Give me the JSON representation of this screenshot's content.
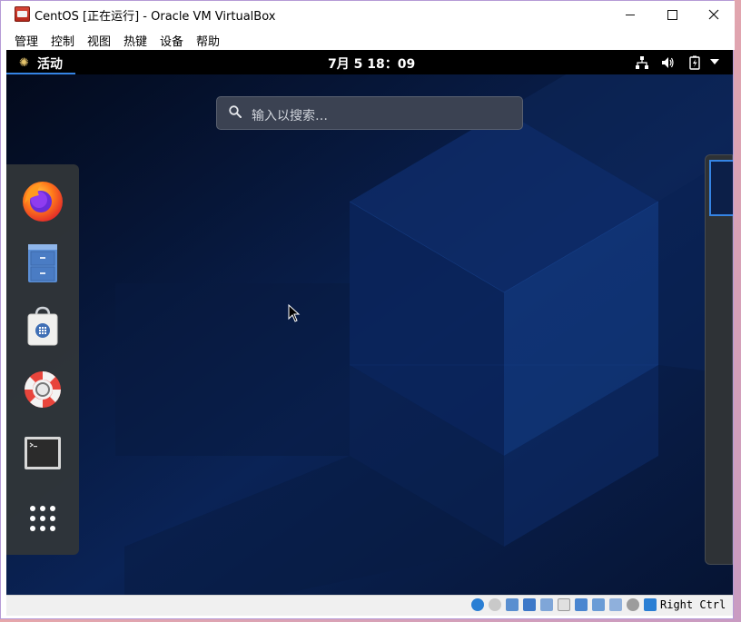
{
  "window": {
    "title": "CentOS [正在运行] - Oracle VM VirtualBox",
    "controls": {
      "minimize": "minimize-icon",
      "maximize": "maximize-icon",
      "close": "close-icon"
    }
  },
  "menubar": {
    "items": [
      "管理",
      "控制",
      "视图",
      "热键",
      "设备",
      "帮助"
    ]
  },
  "guest": {
    "topbar": {
      "activities_label": "活动",
      "clock": "7月 5  18：09",
      "system_icons": [
        "network-icon",
        "volume-icon",
        "battery-icon",
        "dropdown-arrow-icon"
      ]
    },
    "search": {
      "placeholder": "输入以搜索…"
    },
    "dash": {
      "apps": [
        "firefox-icon",
        "files-icon",
        "software-icon",
        "help-icon",
        "terminal-icon",
        "show-apps-icon"
      ]
    },
    "colors": {
      "accent": "#3584e4",
      "wallpaper": "#061129",
      "topbar": "#000000"
    }
  },
  "statusbar": {
    "icons": [
      "hard-disk-icon",
      "optical-drive-icon",
      "audio-icon",
      "network-adapter-icon",
      "usb-icon",
      "shared-folder-icon",
      "display-icon",
      "recording-icon",
      "cpu-icon",
      "mouse-integration-icon",
      "keyboard-capture-icon"
    ],
    "host_key": "Right Ctrl"
  }
}
